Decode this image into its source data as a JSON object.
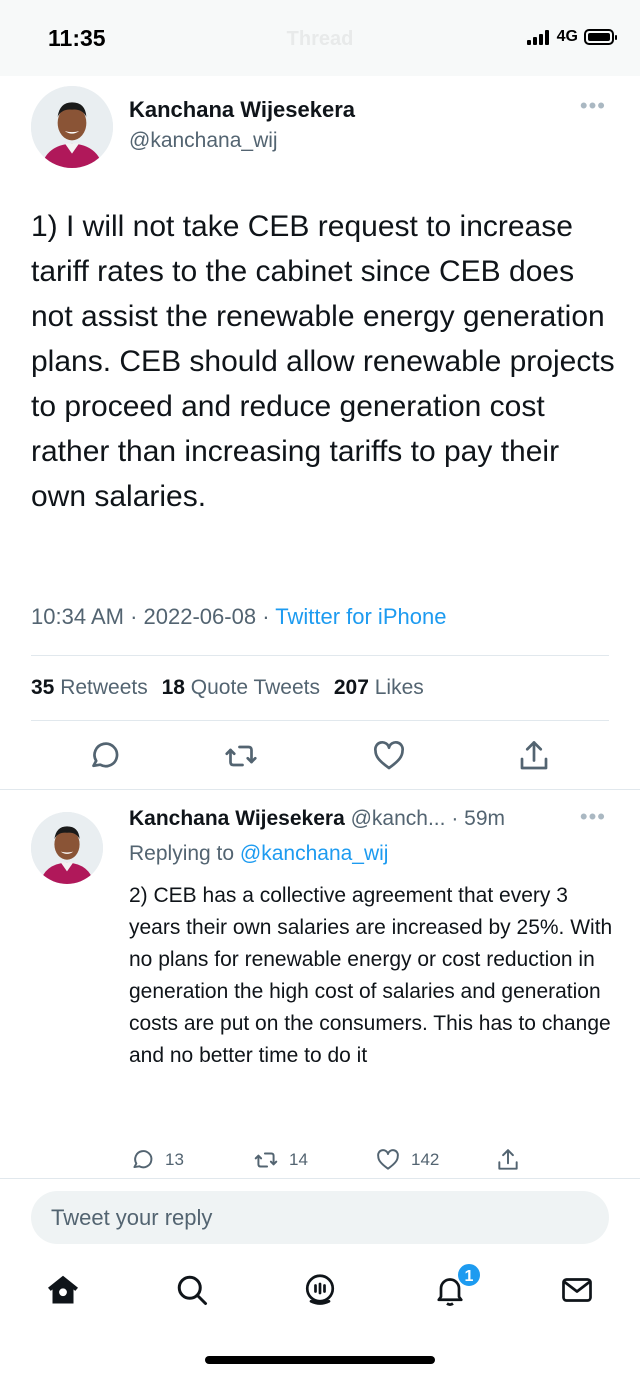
{
  "status_bar": {
    "time": "11:35",
    "network": "4G",
    "signal_bars": 4,
    "battery_level": 1.0,
    "nav_title": "Thread"
  },
  "tweet": {
    "author_name": "Kanchana Wijesekera",
    "author_handle": "@kanchana_wij",
    "more_icon": "more-horizontal-icon",
    "text": "1) I will not take CEB request to increase tariff rates to the cabinet since CEB does not assist the renewable energy generation plans. CEB should allow renewable projects to proceed and reduce generation cost rather than increasing tariffs to pay their own salaries.",
    "time": "10:34 AM",
    "date": "2022-06-08",
    "source": "Twitter for iPhone",
    "separator": "·",
    "stats": {
      "retweets_count": "35",
      "retweets_label": "Retweets",
      "quotes_count": "18",
      "quotes_label": "Quote Tweets",
      "likes_count": "207",
      "likes_label": "Likes"
    },
    "actions": [
      "reply-icon",
      "retweet-icon",
      "like-icon",
      "share-icon"
    ]
  },
  "reply": {
    "author_name": "Kanchana Wijesekera",
    "author_handle_truncated": "@kanch...",
    "age": "· 59m",
    "replying_prefix": "Replying to",
    "replying_to": "@kanchana_wij",
    "text": "2) CEB has a collective agreement that every 3 years their own salaries are increased by 25%. With no plans for renewable energy or cost reduction in generation the high cost of salaries and generation costs are put on the consumers. This has to change and no better time to do it",
    "replies": "13",
    "retweets": "14",
    "likes": "142"
  },
  "composer": {
    "placeholder": "Tweet your reply"
  },
  "tab_bar": {
    "items": [
      "home-icon",
      "search-icon",
      "spaces-icon",
      "notifications-icon",
      "messages-icon"
    ],
    "notifications_badge": "1"
  },
  "colors": {
    "accent": "#1d9bf0",
    "text_primary": "#0f1419",
    "text_secondary": "#536471",
    "divider": "#e1e8ed"
  }
}
